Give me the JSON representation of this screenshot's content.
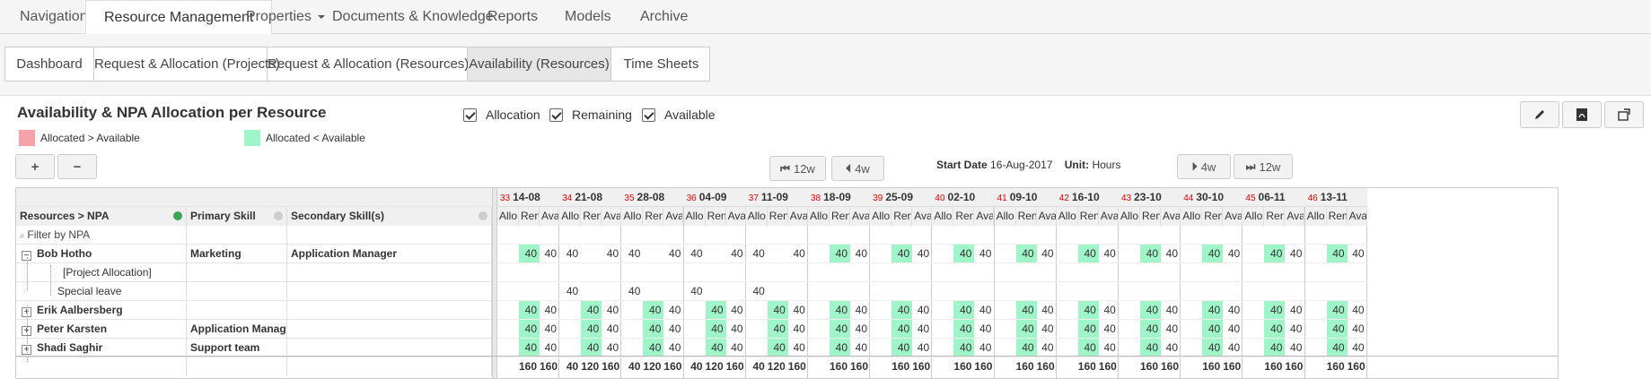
{
  "topnav": [
    {
      "label": "Navigation",
      "active": false,
      "caret": false
    },
    {
      "label": "Resource Management",
      "active": true,
      "caret": false
    },
    {
      "label": "Properties",
      "active": false,
      "caret": true
    },
    {
      "label": "Documents & Knowledge",
      "active": false,
      "caret": false
    },
    {
      "label": "Reports",
      "active": false,
      "caret": false
    },
    {
      "label": "Models",
      "active": false,
      "caret": false
    },
    {
      "label": "Archive",
      "active": false,
      "caret": false
    }
  ],
  "subnav": [
    {
      "label": "Dashboard",
      "active": false
    },
    {
      "label": "Request & Allocation (Projects)",
      "active": false
    },
    {
      "label": "Request & Allocation (Resources)",
      "active": false
    },
    {
      "label": "Availability (Resources)",
      "active": true
    },
    {
      "label": "Time Sheets",
      "active": false
    }
  ],
  "panel": {
    "title": "Availability & NPA Allocation per Resource",
    "checkboxes": [
      {
        "label": "Allocation",
        "checked": true
      },
      {
        "label": "Remaining",
        "checked": true
      },
      {
        "label": "Available",
        "checked": true
      }
    ],
    "legend": [
      {
        "label": "Allocated > Available",
        "color": "#f5a3a8"
      },
      {
        "label": "Allocated < Available",
        "color": "#9ff5c8"
      }
    ],
    "expand_all": "+",
    "collapse_all": "−",
    "nav": {
      "back12": "12w",
      "back4": "4w",
      "fwd4": "4w",
      "fwd12": "12w"
    },
    "start_date_label": "Start Date",
    "start_date": "16-Aug-2017",
    "unit_label": "Unit:",
    "unit": "Hours"
  },
  "grid": {
    "columns": {
      "resource": "Resources > NPA",
      "primary": "Primary Skill",
      "secondary": "Secondary Skill(s)"
    },
    "filter_placeholder": "Filter by NPA",
    "subcols": [
      "Allo",
      "Ren",
      "Ava"
    ],
    "rows": [
      {
        "name": "Bob Hotho",
        "level": 0,
        "expander": "−",
        "bold": true,
        "primary": "Marketing",
        "secondary": "Application Manager"
      },
      {
        "name": "[Project Allocation]",
        "level": 2,
        "expander": "",
        "bold": false,
        "primary": "",
        "secondary": ""
      },
      {
        "name": "Special leave",
        "level": 1,
        "expander": "",
        "bold": false,
        "primary": "",
        "secondary": ""
      },
      {
        "name": "Erik Aalbersberg",
        "level": 0,
        "expander": "+",
        "bold": true,
        "primary": "",
        "secondary": ""
      },
      {
        "name": "Peter Karsten",
        "level": 0,
        "expander": "+",
        "bold": true,
        "primary": "Application Manag",
        "secondary": ""
      },
      {
        "name": "Shadi Saghir",
        "level": 0,
        "expander": "+",
        "bold": true,
        "primary": "Support team",
        "secondary": ""
      }
    ],
    "weeks": [
      {
        "num": "33",
        "date": "14-08",
        "values": [
          [
            "",
            "40",
            "40"
          ],
          [
            "",
            "",
            ""
          ],
          [
            "",
            "",
            ""
          ],
          [
            "",
            "40",
            "40"
          ],
          [
            "",
            "40",
            "40"
          ],
          [
            "",
            "40",
            "40"
          ]
        ],
        "totals": [
          "",
          "160",
          "160"
        ]
      },
      {
        "num": "34",
        "date": "21-08",
        "values": [
          [
            "40",
            "",
            "40"
          ],
          [
            "",
            "",
            ""
          ],
          [
            "40",
            "",
            ""
          ],
          [
            "",
            "40",
            "40"
          ],
          [
            "",
            "40",
            "40"
          ],
          [
            "",
            "40",
            "40"
          ]
        ],
        "totals": [
          "40",
          "120",
          "160"
        ]
      },
      {
        "num": "35",
        "date": "28-08",
        "values": [
          [
            "40",
            "",
            "40"
          ],
          [
            "",
            "",
            ""
          ],
          [
            "40",
            "",
            ""
          ],
          [
            "",
            "40",
            "40"
          ],
          [
            "",
            "40",
            "40"
          ],
          [
            "",
            "40",
            "40"
          ]
        ],
        "totals": [
          "40",
          "120",
          "160"
        ]
      },
      {
        "num": "36",
        "date": "04-09",
        "values": [
          [
            "40",
            "",
            "40"
          ],
          [
            "",
            "",
            ""
          ],
          [
            "40",
            "",
            ""
          ],
          [
            "",
            "40",
            "40"
          ],
          [
            "",
            "40",
            "40"
          ],
          [
            "",
            "40",
            "40"
          ]
        ],
        "totals": [
          "40",
          "120",
          "160"
        ]
      },
      {
        "num": "37",
        "date": "11-09",
        "values": [
          [
            "40",
            "",
            "40"
          ],
          [
            "",
            "",
            ""
          ],
          [
            "40",
            "",
            ""
          ],
          [
            "",
            "40",
            "40"
          ],
          [
            "",
            "40",
            "40"
          ],
          [
            "",
            "40",
            "40"
          ]
        ],
        "totals": [
          "40",
          "120",
          "160"
        ]
      },
      {
        "num": "38",
        "date": "18-09",
        "values": [
          [
            "",
            "40",
            "40"
          ],
          [
            "",
            "",
            ""
          ],
          [
            "",
            "",
            ""
          ],
          [
            "",
            "40",
            "40"
          ],
          [
            "",
            "40",
            "40"
          ],
          [
            "",
            "40",
            "40"
          ]
        ],
        "totals": [
          "",
          "160",
          "160"
        ]
      },
      {
        "num": "39",
        "date": "25-09",
        "values": [
          [
            "",
            "40",
            "40"
          ],
          [
            "",
            "",
            ""
          ],
          [
            "",
            "",
            ""
          ],
          [
            "",
            "40",
            "40"
          ],
          [
            "",
            "40",
            "40"
          ],
          [
            "",
            "40",
            "40"
          ]
        ],
        "totals": [
          "",
          "160",
          "160"
        ]
      },
      {
        "num": "40",
        "date": "02-10",
        "values": [
          [
            "",
            "40",
            "40"
          ],
          [
            "",
            "",
            ""
          ],
          [
            "",
            "",
            ""
          ],
          [
            "",
            "40",
            "40"
          ],
          [
            "",
            "40",
            "40"
          ],
          [
            "",
            "40",
            "40"
          ]
        ],
        "totals": [
          "",
          "160",
          "160"
        ]
      },
      {
        "num": "41",
        "date": "09-10",
        "values": [
          [
            "",
            "40",
            "40"
          ],
          [
            "",
            "",
            ""
          ],
          [
            "",
            "",
            ""
          ],
          [
            "",
            "40",
            "40"
          ],
          [
            "",
            "40",
            "40"
          ],
          [
            "",
            "40",
            "40"
          ]
        ],
        "totals": [
          "",
          "160",
          "160"
        ]
      },
      {
        "num": "42",
        "date": "16-10",
        "values": [
          [
            "",
            "40",
            "40"
          ],
          [
            "",
            "",
            ""
          ],
          [
            "",
            "",
            ""
          ],
          [
            "",
            "40",
            "40"
          ],
          [
            "",
            "40",
            "40"
          ],
          [
            "",
            "40",
            "40"
          ]
        ],
        "totals": [
          "",
          "160",
          "160"
        ]
      },
      {
        "num": "43",
        "date": "23-10",
        "values": [
          [
            "",
            "40",
            "40"
          ],
          [
            "",
            "",
            ""
          ],
          [
            "",
            "",
            ""
          ],
          [
            "",
            "40",
            "40"
          ],
          [
            "",
            "40",
            "40"
          ],
          [
            "",
            "40",
            "40"
          ]
        ],
        "totals": [
          "",
          "160",
          "160"
        ]
      },
      {
        "num": "44",
        "date": "30-10",
        "values": [
          [
            "",
            "40",
            "40"
          ],
          [
            "",
            "",
            ""
          ],
          [
            "",
            "",
            ""
          ],
          [
            "",
            "40",
            "40"
          ],
          [
            "",
            "40",
            "40"
          ],
          [
            "",
            "40",
            "40"
          ]
        ],
        "totals": [
          "",
          "160",
          "160"
        ]
      },
      {
        "num": "45",
        "date": "06-11",
        "values": [
          [
            "",
            "40",
            "40"
          ],
          [
            "",
            "",
            ""
          ],
          [
            "",
            "",
            ""
          ],
          [
            "",
            "40",
            "40"
          ],
          [
            "",
            "40",
            "40"
          ],
          [
            "",
            "40",
            "40"
          ]
        ],
        "totals": [
          "",
          "160",
          "160"
        ]
      },
      {
        "num": "46",
        "date": "13-11",
        "values": [
          [
            "",
            "40",
            "40"
          ],
          [
            "",
            "",
            ""
          ],
          [
            "",
            "",
            ""
          ],
          [
            "",
            "40",
            "40"
          ],
          [
            "",
            "40",
            "40"
          ],
          [
            "",
            "40",
            "40"
          ]
        ],
        "totals": [
          "",
          "160",
          "160"
        ]
      }
    ],
    "highlight_color": "#9ff5c8"
  }
}
